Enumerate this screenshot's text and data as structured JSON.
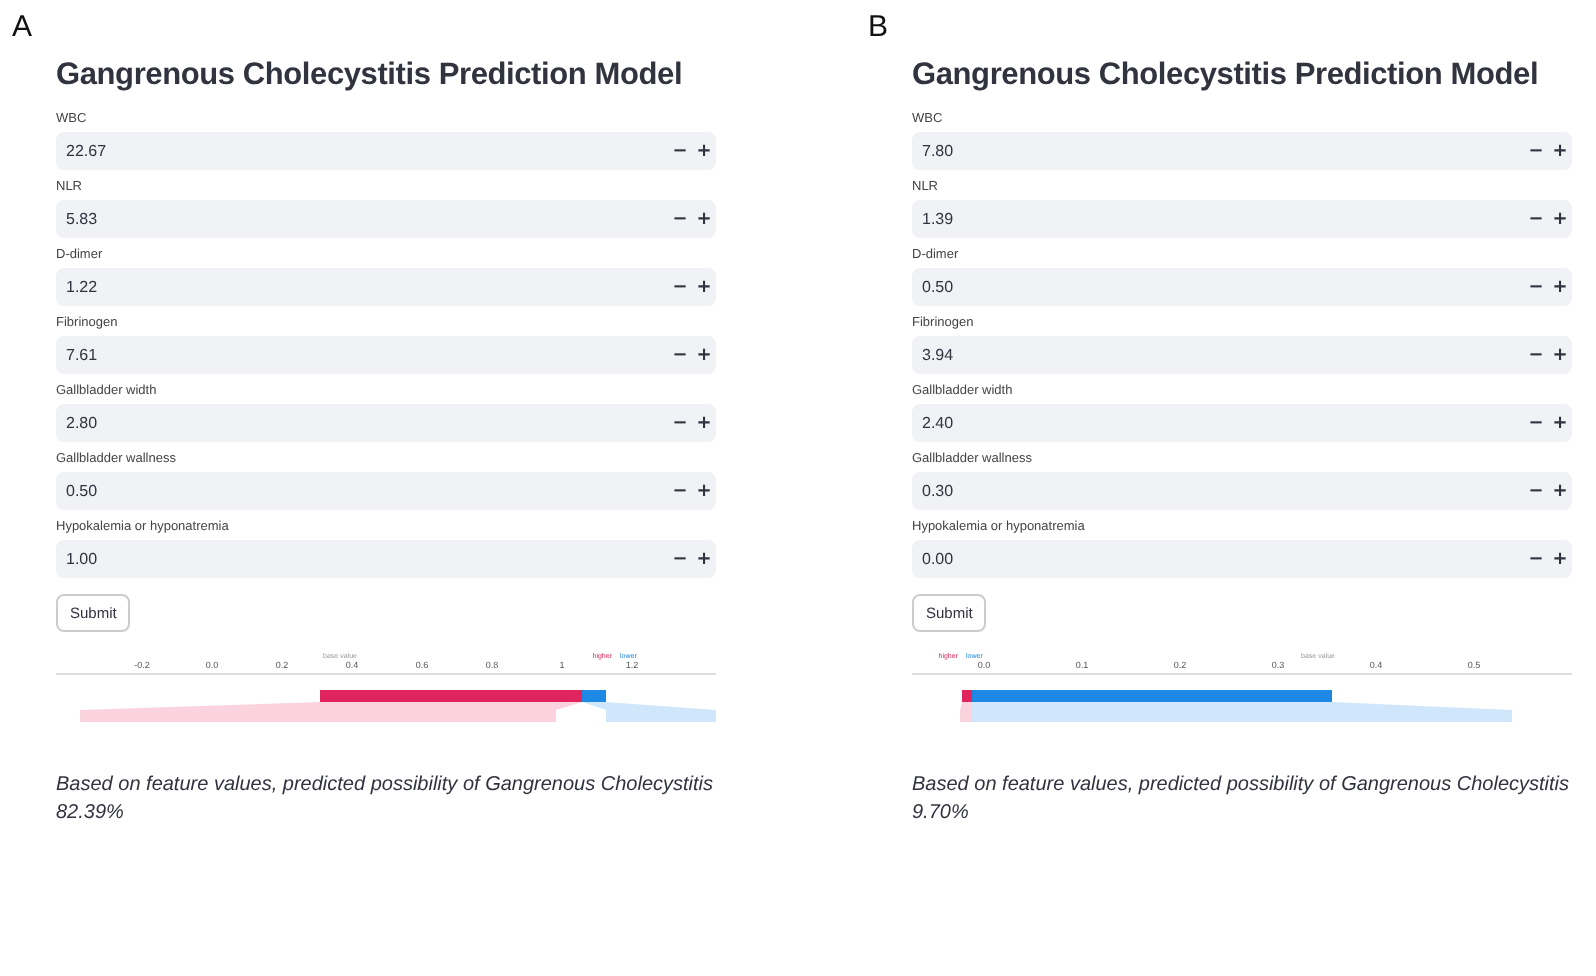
{
  "panels": [
    {
      "letter": "A",
      "title": "Gangrenous Cholecystitis Prediction Model",
      "fields": [
        {
          "label": "WBC",
          "value": "22.67"
        },
        {
          "label": "NLR",
          "value": "5.83"
        },
        {
          "label": "D-dimer",
          "value": "1.22"
        },
        {
          "label": "Fibrinogen",
          "value": "7.61"
        },
        {
          "label": "Gallbladder width",
          "value": "2.80"
        },
        {
          "label": "Gallbladder wallness",
          "value": "0.50"
        },
        {
          "label": "Hypokalemia or hyponatremia",
          "value": "1.00"
        }
      ],
      "submit": "Submit",
      "minus": "−",
      "plus": "+",
      "force_plot": {
        "kind": "positive",
        "ticks": [
          "-0.2",
          "0.0",
          "0.2",
          "0.4",
          "0.6",
          "0.8",
          "1",
          "1.2"
        ],
        "base_label": "base value",
        "higher": "higher",
        "lower": "lower"
      },
      "result": "Based on feature values, predicted possibility of Gangrenous Cholecystitis",
      "percent": "82.39%"
    },
    {
      "letter": "B",
      "title": "Gangrenous Cholecystitis Prediction Model",
      "fields": [
        {
          "label": "WBC",
          "value": "7.80"
        },
        {
          "label": "NLR",
          "value": "1.39"
        },
        {
          "label": "D-dimer",
          "value": "0.50"
        },
        {
          "label": "Fibrinogen",
          "value": "3.94"
        },
        {
          "label": "Gallbladder width",
          "value": "2.40"
        },
        {
          "label": "Gallbladder wallness",
          "value": "0.30"
        },
        {
          "label": "Hypokalemia or hyponatremia",
          "value": "0.00"
        }
      ],
      "submit": "Submit",
      "minus": "−",
      "plus": "+",
      "force_plot": {
        "kind": "negative",
        "ticks": [
          "0.0",
          "0.1",
          "0.2",
          "0.3",
          "0.4",
          "0.5"
        ],
        "base_label": "base value",
        "higher": "higher",
        "lower": "lower"
      },
      "result": "Based on feature values, predicted possibility of Gangrenous Cholecystitis",
      "percent": "9.70%"
    }
  ]
}
